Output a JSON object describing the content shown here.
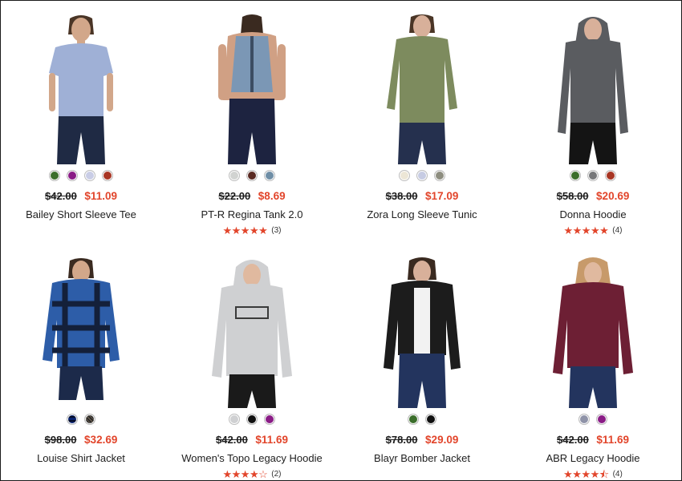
{
  "products": [
    {
      "name": "Bailey Short Sleeve Tee",
      "price_original": "$42.00",
      "price_sale": "$11.09",
      "swatches": [
        "#3b6e2b",
        "#8a1c86",
        "#c9cde6",
        "#a83523"
      ],
      "rating": null,
      "rating_stars": "",
      "review_count": ""
    },
    {
      "name": "PT-R Regina Tank 2.0",
      "price_original": "$22.00",
      "price_sale": "$8.69",
      "swatches": [
        "#d1d3d1",
        "#5a2a22",
        "#6f8ea6"
      ],
      "rating": 5,
      "rating_stars": "★★★★★",
      "review_count": "(3)"
    },
    {
      "name": "Zora Long Sleeve Tunic",
      "price_original": "$38.00",
      "price_sale": "$17.09",
      "swatches": [
        "#ece6d6",
        "#c7cce3",
        "#8e8e80"
      ],
      "rating": null,
      "rating_stars": "",
      "review_count": ""
    },
    {
      "name": "Donna Hoodie",
      "price_original": "$58.00",
      "price_sale": "$20.69",
      "swatches": [
        "#3b6e2b",
        "#77787a",
        "#a83523"
      ],
      "rating": 5,
      "rating_stars": "★★★★★",
      "review_count": "(4)"
    },
    {
      "name": "Louise Shirt Jacket",
      "price_original": "$98.00",
      "price_sale": "$32.69",
      "swatches": [
        "plaid-blue",
        "plaid-black"
      ],
      "rating": null,
      "rating_stars": "",
      "review_count": ""
    },
    {
      "name": "Women's Topo Legacy Hoodie",
      "price_original": "$42.00",
      "price_sale": "$11.69",
      "swatches": [
        "#cfd0d2",
        "#111111",
        "#8a1c86"
      ],
      "rating": 4,
      "rating_stars": "★★★★☆",
      "review_count": "(2)"
    },
    {
      "name": "Blayr Bomber Jacket",
      "price_original": "$78.00",
      "price_sale": "$29.09",
      "swatches": [
        "#3b6e2b",
        "#111111"
      ],
      "rating": null,
      "rating_stars": "",
      "review_count": ""
    },
    {
      "name": "ABR Legacy Hoodie",
      "price_original": "$42.00",
      "price_sale": "$11.69",
      "swatches": [
        "#8f93a8",
        "#8a1c86"
      ],
      "rating": 4.5,
      "rating_stars": "★★★★⯪",
      "review_count": "(4)"
    }
  ],
  "colors": {
    "sale_price": "#e2452b",
    "rating_star": "#e2452b"
  }
}
